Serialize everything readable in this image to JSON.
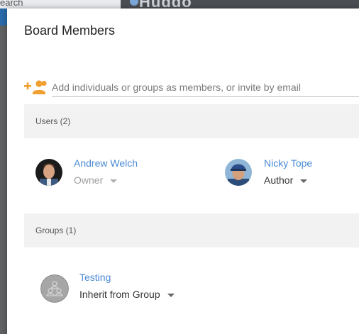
{
  "background": {
    "search_text": "earch",
    "logo_text": "Huddo"
  },
  "dialog": {
    "title": "Board Members",
    "add_input": {
      "placeholder": "Add individuals or groups as members, or invite by email",
      "value": ""
    },
    "users_section": {
      "header": "Users (2)",
      "members": [
        {
          "name": "Andrew Welch",
          "role": "Owner"
        },
        {
          "name": "Nicky Tope",
          "role": "Author"
        }
      ]
    },
    "groups_section": {
      "header": "Groups (1)",
      "groups": [
        {
          "name": "Testing",
          "role": "Inherit from Group"
        }
      ]
    }
  },
  "icons": {
    "add_member": "add-person-icon",
    "group_avatar": "group-icon",
    "role_dropdown": "caret-down-icon"
  },
  "colors": {
    "accent_orange": "#f0a030",
    "link_blue": "#4a8ad4"
  }
}
